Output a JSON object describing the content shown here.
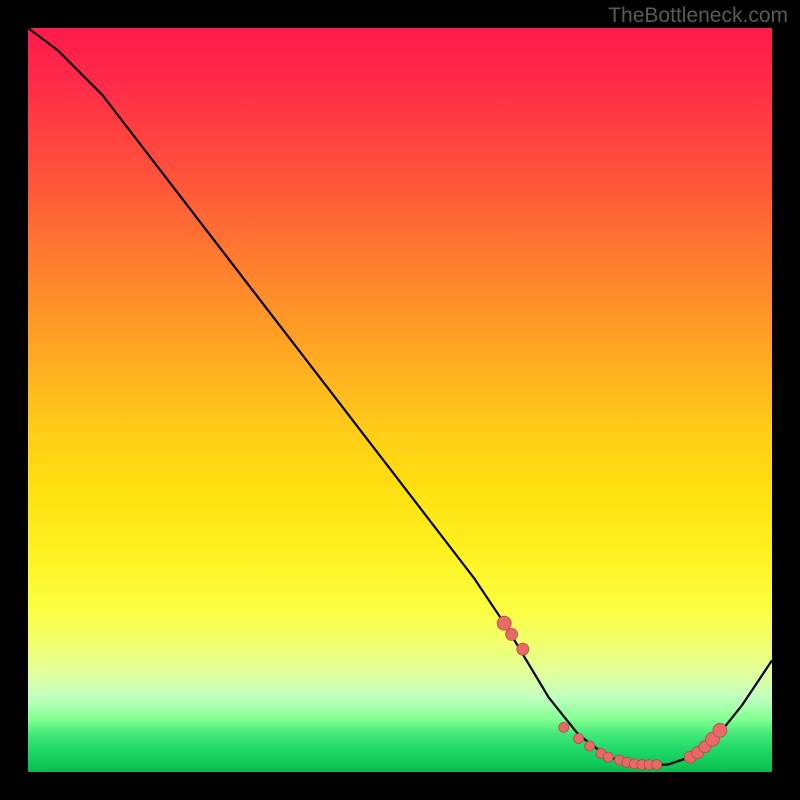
{
  "watermark": "TheBottleneck.com",
  "chart_data": {
    "type": "line",
    "title": "",
    "xlabel": "",
    "ylabel": "",
    "xlim": [
      0,
      100
    ],
    "ylim": [
      0,
      100
    ],
    "background_gradient": [
      {
        "stop": 0,
        "color": "#ff1a4a"
      },
      {
        "stop": 50,
        "color": "#ffc018"
      },
      {
        "stop": 80,
        "color": "#fcff40"
      },
      {
        "stop": 100,
        "color": "#08b850"
      }
    ],
    "series": [
      {
        "name": "bottleneck-curve",
        "x": [
          0,
          4,
          10,
          20,
          30,
          40,
          50,
          60,
          64,
          67,
          70,
          74,
          78,
          82,
          86,
          89,
          92,
          96,
          100
        ],
        "y": [
          100,
          97,
          91,
          78,
          65,
          52,
          39,
          26,
          20,
          15,
          10,
          5,
          2,
          1,
          1,
          2,
          4,
          9,
          15
        ]
      }
    ],
    "scatter_points": {
      "name": "highlight-dots",
      "x": [
        64,
        65,
        66.5,
        72,
        74,
        75.5,
        77,
        78,
        79.5,
        80.5,
        81.5,
        82.5,
        83.5,
        84.5,
        89,
        90,
        91,
        92,
        93
      ],
      "y": [
        20,
        18.5,
        16.5,
        6,
        4.5,
        3.5,
        2.5,
        2,
        1.6,
        1.3,
        1.1,
        1.0,
        1.0,
        1.0,
        2.0,
        2.6,
        3.4,
        4.4,
        5.6
      ],
      "r": [
        7,
        6,
        6,
        5,
        5,
        5,
        5,
        5,
        5,
        5,
        5,
        5,
        5,
        5,
        6,
        6,
        6,
        7,
        7
      ]
    }
  }
}
